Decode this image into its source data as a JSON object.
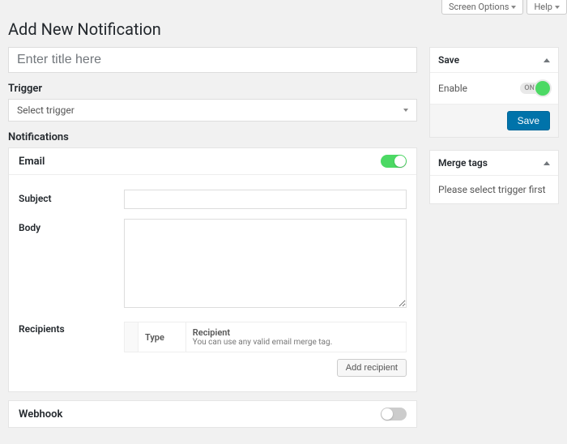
{
  "topButtons": {
    "screenOptions": "Screen Options",
    "help": "Help"
  },
  "pageTitle": "Add New Notification",
  "titlePlaceholder": "Enter title here",
  "trigger": {
    "label": "Trigger",
    "placeholder": "Select trigger"
  },
  "notificationsLabel": "Notifications",
  "email": {
    "title": "Email",
    "subjectLabel": "Subject",
    "bodyLabel": "Body",
    "recipientsLabel": "Recipients",
    "typeHeader": "Type",
    "recipientHeader": "Recipient",
    "recipientHint": "You can use any valid email merge tag.",
    "addRecipient": "Add recipient"
  },
  "webhook": {
    "title": "Webhook"
  },
  "save": {
    "title": "Save",
    "enable": "Enable",
    "onLabel": "ON",
    "button": "Save"
  },
  "mergeTags": {
    "title": "Merge tags",
    "body": "Please select trigger first"
  }
}
